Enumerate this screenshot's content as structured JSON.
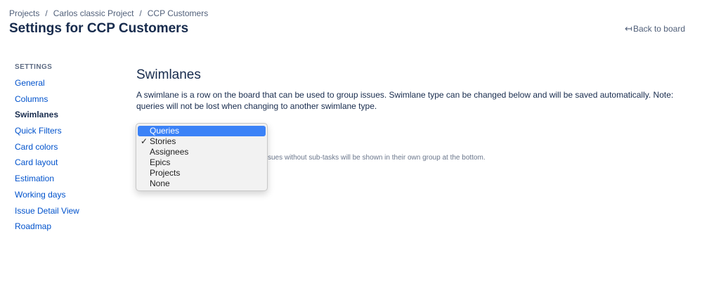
{
  "breadcrumb": {
    "items": [
      "Projects",
      "Carlos classic Project",
      "CCP Customers"
    ],
    "separator": "/"
  },
  "header": {
    "title": "Settings for CCP Customers",
    "back_label": "Back to board",
    "back_icon": "arrow-left-icon"
  },
  "sidebar": {
    "heading": "SETTINGS",
    "items": [
      {
        "label": "General"
      },
      {
        "label": "Columns"
      },
      {
        "label": "Swimlanes",
        "active": true
      },
      {
        "label": "Quick Filters"
      },
      {
        "label": "Card colors"
      },
      {
        "label": "Card layout"
      },
      {
        "label": "Estimation"
      },
      {
        "label": "Working days"
      },
      {
        "label": "Issue Detail View"
      },
      {
        "label": "Roadmap"
      }
    ]
  },
  "main": {
    "title": "Swimlanes",
    "description": "A swimlane is a row on the board that can be used to group issues. Swimlane type can be changed below and will be saved automatically. Note: queries will not be lost when changing to another swimlane type.",
    "helper_text": "sues without sub-tasks will be shown in their own group at the bottom."
  },
  "swimlane_select": {
    "selected": "Stories",
    "highlighted": "Queries",
    "check_mark": "✓",
    "options": [
      "Queries",
      "Stories",
      "Assignees",
      "Epics",
      "Projects",
      "None"
    ]
  },
  "colors": {
    "link": "#0052cc",
    "text": "#172b4d",
    "highlight": "#3b82f7",
    "focus_border": "#2684ff"
  }
}
